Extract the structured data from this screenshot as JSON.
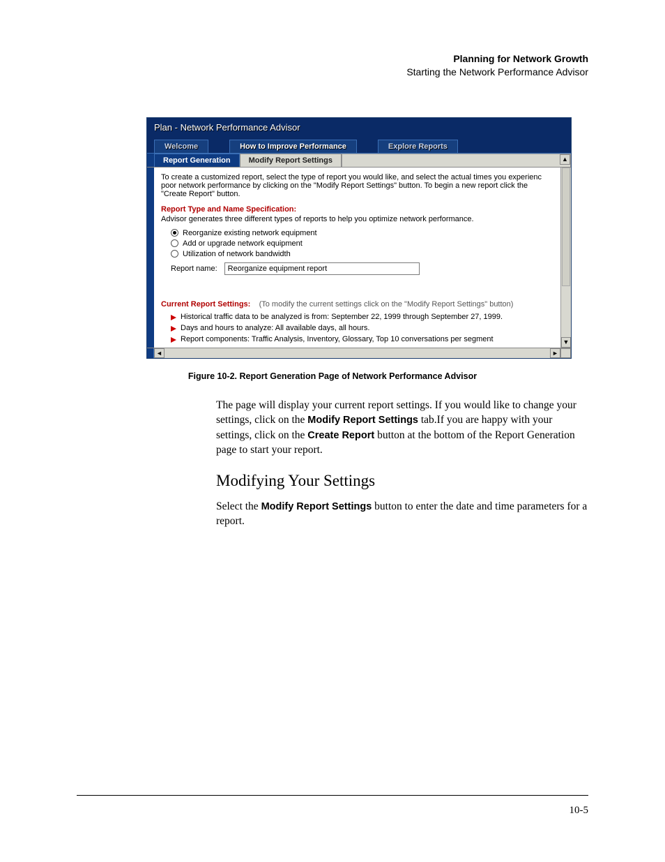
{
  "header": {
    "bold": "Planning for Network Growth",
    "sub": "Starting the Network Performance Advisor"
  },
  "app": {
    "title": "Plan - Network Performance Advisor",
    "topTabs": {
      "welcome": "Welcome",
      "howto": "How to Improve Performance",
      "explore": "Explore Reports"
    },
    "subTabs": {
      "reportGen": "Report Generation",
      "modify": "Modify Report Settings"
    },
    "intro": "To create a customized report, select the type of report you would like, and select the actual times you experienc poor network performance by clicking on the \"Modify Report Settings\" button. To begin a new report click the \"Create Report\" button.",
    "sectionTitle": "Report Type and Name Specification:",
    "sectionDesc": "Advisor generates three different types of reports to help you optimize network performance.",
    "radios": {
      "r1": "Reorganize existing network equipment",
      "r2": "Add or upgrade network equipment",
      "r3": "Utilization of network bandwidth"
    },
    "reportNameLabel": "Report name:",
    "reportNameValue": "Reorganize equipment report",
    "crs": {
      "label": "Current Report Settings:",
      "hint": "(To modify the current settings click on the \"Modify Report Settings\" button)",
      "b1": "Historical traffic data to be analyzed is from: September 22, 1999 through September 27, 1999.",
      "b2": "Days and hours to analyze: All available days, all hours.",
      "b3": "Report components: Traffic Analysis, Inventory, Glossary, Top 10 conversations per segment"
    }
  },
  "figureCaption": "Figure 10-2.  Report Generation Page of Network Performance Advisor",
  "body": {
    "p1a": "The page will display your current report settings. If you would like to change your settings, click on the ",
    "p1b_bold": "Modify Report Settings",
    "p1c": " tab.If you are happy with your settings, click on the ",
    "p1d_bold": "Create Report",
    "p1e": " button at the bottom of the Report Generation page to start your report.",
    "h2": "Modifying Your Settings",
    "p2a": "Select the ",
    "p2b_bold": "Modify Report Settings",
    "p2c": " button to enter the date and time parameters for a report."
  },
  "pageNumber": "10-5"
}
